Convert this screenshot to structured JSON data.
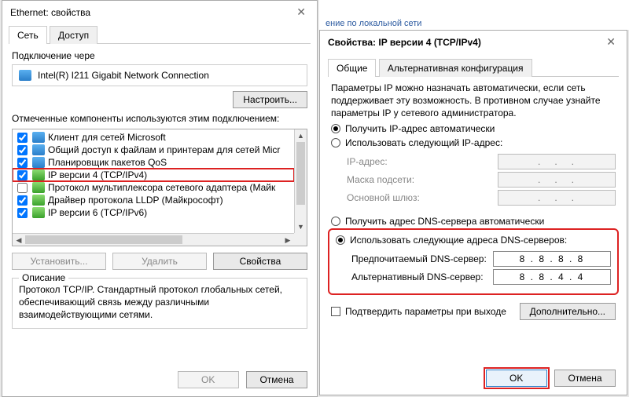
{
  "leftWin": {
    "title": "Ethernet: свойства",
    "tabs": {
      "net": "Сеть",
      "access": "Доступ"
    },
    "conn_label": "Подключение чере",
    "adapter": "Intel(R) I211 Gigabit Network Connection",
    "configure_btn": "Настроить...",
    "components_label": "Отмеченные компоненты используются этим подключением:",
    "items": [
      {
        "checked": true,
        "cls": "net",
        "text": "Клиент для сетей Microsoft"
      },
      {
        "checked": true,
        "cls": "net",
        "text": "Общий доступ к файлам и принтерам для сетей Micr"
      },
      {
        "checked": true,
        "cls": "net",
        "text": "Планировщик пакетов QoS"
      },
      {
        "checked": true,
        "cls": "green",
        "text": "IP версии 4 (TCP/IPv4)",
        "hl": true
      },
      {
        "checked": false,
        "cls": "green",
        "text": "Протокол мультиплексора сетевого адаптера (Майк"
      },
      {
        "checked": true,
        "cls": "green",
        "text": "Драйвер протокола LLDP (Майкрософт)"
      },
      {
        "checked": true,
        "cls": "green",
        "text": "IP версии 6 (TCP/IPv6)"
      }
    ],
    "install_btn": "Установить...",
    "remove_btn": "Удалить",
    "props_btn": "Свойства",
    "desc_title": "Описание",
    "desc_text": "Протокол TCP/IP. Стандартный протокол глобальных сетей, обеспечивающий связь между различными взаимодействующими сетями.",
    "ok": "OK",
    "cancel": "Отмена"
  },
  "strip": {
    "caption": "ение по локальной сети"
  },
  "rightWin": {
    "title": "Свойства: IP версии 4 (TCP/IPv4)",
    "tabs": {
      "general": "Общие",
      "alt": "Альтернативная конфигурация"
    },
    "param_text": "Параметры IP можно назначать автоматически, если сеть поддерживает эту возможность. В противном случае узнайте параметры IP у сетевого администратора.",
    "ip_auto": "Получить IP-адрес автоматически",
    "ip_manual": "Использовать следующий IP-адрес:",
    "ip_lbl": "IP-адрес:",
    "mask_lbl": "Маска подсети:",
    "gw_lbl": "Основной шлюз:",
    "dot_placeholder": ".   .   .",
    "dns_auto": "Получить адрес DNS-сервера автоматически",
    "dns_manual": "Использовать следующие адреса DNS-серверов:",
    "dns_pref_lbl": "Предпочитаемый DNS-сервер:",
    "dns_alt_lbl": "Альтернативный DNS-сервер:",
    "dns_pref_val": "8 . 8 . 8 . 8",
    "dns_alt_val": "8 . 8 . 4 . 4",
    "confirm": "Подтвердить параметры при выходе",
    "advanced": "Дополнительно...",
    "ok": "OK",
    "cancel": "Отмена"
  }
}
